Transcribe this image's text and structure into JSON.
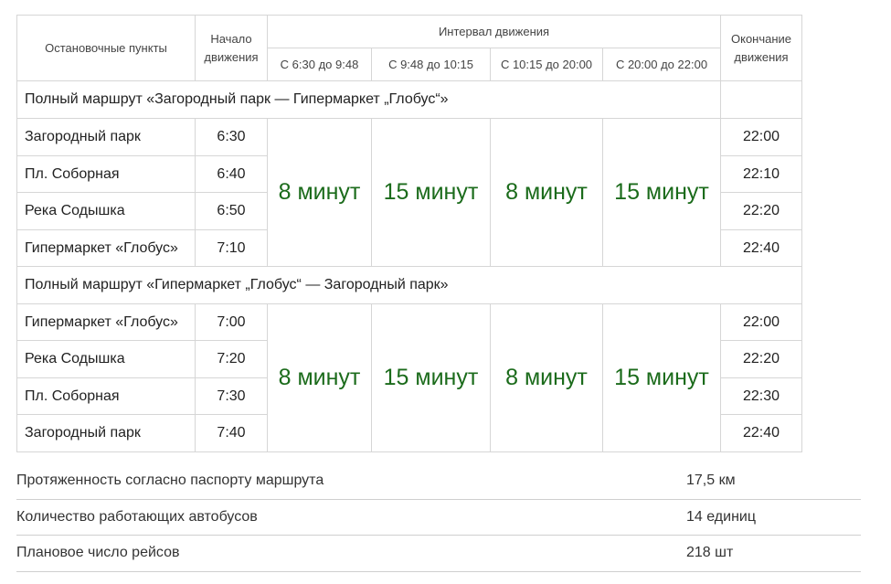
{
  "header": {
    "stops_col": "Остановочные пункты",
    "start_col": "Начало движения",
    "interval_group": "Интервал движения",
    "end_col": "Окончание движения",
    "intervals": [
      "С 6:30 до 9:48",
      "С 9:48 до 10:15",
      "С 10:15 до 20:00",
      "С 20:00 до 22:00"
    ]
  },
  "routes": [
    {
      "title": "Полный маршрут «Загородный парк — Гипермаркет „Глобус“»",
      "stops": [
        {
          "name": "Загородный парк",
          "start": "6:30",
          "end": "22:00"
        },
        {
          "name": "Пл. Соборная",
          "start": "6:40",
          "end": "22:10"
        },
        {
          "name": "Река Содышка",
          "start": "6:50",
          "end": "22:20"
        },
        {
          "name": "Гипермаркет «Глобус»",
          "start": "7:10",
          "end": "22:40"
        }
      ],
      "intervals": [
        "8 минут",
        "15 минут",
        "8 минут",
        "15 минут"
      ]
    },
    {
      "title": "Полный маршрут «Гипермаркет „Глобус“ — Загородный парк»",
      "stops": [
        {
          "name": "Гипермаркет «Глобус»",
          "start": "7:00",
          "end": "22:00"
        },
        {
          "name": "Река Содышка",
          "start": "7:20",
          "end": "22:20"
        },
        {
          "name": "Пл. Соборная",
          "start": "7:30",
          "end": "22:30"
        },
        {
          "name": "Загородный парк",
          "start": "7:40",
          "end": "22:40"
        }
      ],
      "intervals": [
        "8 минут",
        "15 минут",
        "8 минут",
        "15 минут"
      ]
    }
  ],
  "stats": [
    {
      "label": "Протяженность согласно паспорту маршрута",
      "value": "17,5 км"
    },
    {
      "label": "Количество работающих автобусов",
      "value": "14 единиц"
    },
    {
      "label": "Плановое число рейсов",
      "value": "218 шт"
    }
  ],
  "colors": {
    "interval_text": "#1b6b1b",
    "border": "#d6d6d6"
  }
}
